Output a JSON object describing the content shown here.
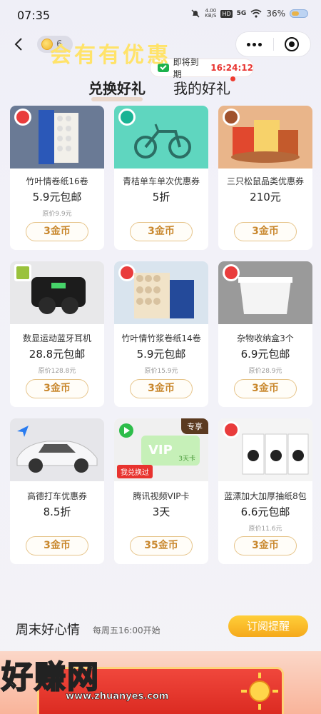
{
  "status_bar": {
    "time": "07:35",
    "net_speed_value": "4.00",
    "net_speed_unit": "KB/S",
    "hd": "HD",
    "signal": "5G",
    "battery": "36%"
  },
  "header": {
    "coin_count": "6",
    "expiry_label": "即将到期",
    "expiry_time": "16:24:12"
  },
  "tabs": {
    "exchange": "兑换好礼",
    "mine": "我的好礼"
  },
  "products": [
    {
      "name": "竹叶情卷纸16卷",
      "price": "5.9元包邮",
      "original": "原价9.9元",
      "cost": "3金币"
    },
    {
      "name": "青桔单车单次优惠券",
      "price": "5折",
      "original": "",
      "cost": "3金币"
    },
    {
      "name": "三只松鼠品类优惠券",
      "price": "210元",
      "original": "",
      "cost": "3金币"
    },
    {
      "name": "数显运动蓝牙耳机",
      "price": "28.8元包邮",
      "original": "原价128.8元",
      "cost": "3金币"
    },
    {
      "name": "竹叶情竹浆卷纸14卷",
      "price": "5.9元包邮",
      "original": "原价15.9元",
      "cost": "3金币"
    },
    {
      "name": "杂物收纳盒3个",
      "price": "6.9元包邮",
      "original": "原价28.9元",
      "cost": "3金币"
    },
    {
      "name": "高德打车优惠券",
      "price": "8.5折",
      "original": "",
      "cost": "3金币"
    },
    {
      "name": "腾讯视频VIP卡",
      "price": "3天",
      "original": "",
      "cost": "35金币"
    },
    {
      "name": "蓝漂加大加厚抽纸8包",
      "price": "6.6元包邮",
      "original": "原价11.6元",
      "cost": "3金币"
    }
  ],
  "card_tags": {
    "exclusive": "专享",
    "redeemed": "我兑换过",
    "vip_text": "VIP",
    "vip_days": "3天卡"
  },
  "weekend": {
    "title": "周末好心情",
    "subtitle": "每周五16:00开始",
    "subscribe": "订阅提醒"
  },
  "banner": {
    "text": "会有有优惠"
  },
  "watermark": {
    "brand": "好赚网",
    "url": "www.zhuanyes.com"
  },
  "colors": {
    "accent_red": "#e8332f",
    "coin_gold": "#c9882e",
    "subscribe_yellow": "#f5a91b"
  }
}
